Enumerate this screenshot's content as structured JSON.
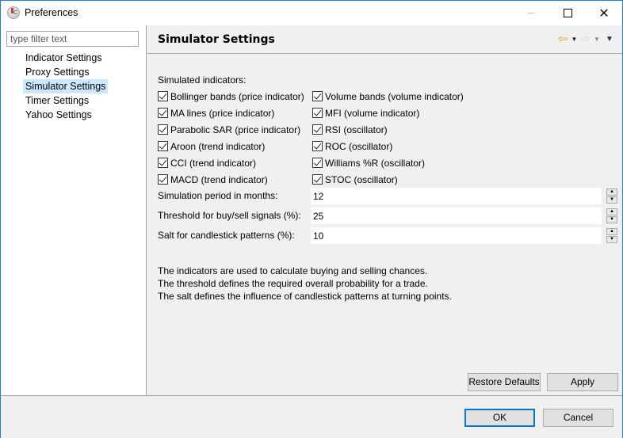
{
  "window": {
    "title": "Preferences",
    "icon": "java-app-icon",
    "controls": {
      "minimize": "minimize-icon",
      "maximize": "maximize-icon",
      "close": "close-icon"
    }
  },
  "sidebar": {
    "filter_placeholder": "type filter text",
    "filter_value": "",
    "items": [
      {
        "label": "Indicator Settings",
        "selected": false
      },
      {
        "label": "Proxy Settings",
        "selected": false
      },
      {
        "label": "Simulator Settings",
        "selected": true
      },
      {
        "label": "Timer Settings",
        "selected": false
      },
      {
        "label": "Yahoo Settings",
        "selected": false
      }
    ]
  },
  "page": {
    "title": "Simulator Settings",
    "nav": {
      "back_icon": "⇦",
      "back_dropdown_icon": "▼",
      "forward_icon": "⇨",
      "forward_dropdown_icon": "▼",
      "menu_icon": "▼"
    },
    "section_label": "Simulated indicators:",
    "checkboxes": [
      {
        "label": "Bollinger bands (price indicator)",
        "checked": true
      },
      {
        "label": "Volume bands (volume indicator)",
        "checked": true
      },
      {
        "label": "MA lines (price indicator)",
        "checked": true
      },
      {
        "label": "MFI (volume indicator)",
        "checked": true
      },
      {
        "label": "Parabolic SAR (price indicator)",
        "checked": true
      },
      {
        "label": "RSI (oscillator)",
        "checked": true
      },
      {
        "label": "Aroon (trend indicator)",
        "checked": true
      },
      {
        "label": "ROC (oscillator)",
        "checked": true
      },
      {
        "label": "CCI (trend indicator)",
        "checked": true
      },
      {
        "label": "Williams %R (oscillator)",
        "checked": true
      },
      {
        "label": "MACD (trend indicator)",
        "checked": true
      },
      {
        "label": "STOC (oscillator)",
        "checked": true
      }
    ],
    "fields": [
      {
        "label": "Simulation period in months:",
        "value": "12"
      },
      {
        "label": "Threshold for buy/sell signals (%):",
        "value": "25"
      },
      {
        "label": "Salt for candlestick patterns (%):",
        "value": "10"
      }
    ],
    "spinner_up": "▲",
    "spinner_down": "▼",
    "help_lines": [
      "The indicators are used to calculate buying and selling chances.",
      "The threshold defines the required overall probability for a trade.",
      "The salt defines the influence of candlestick patterns at turning points."
    ],
    "restore_defaults_label": "Restore Defaults",
    "apply_label": "Apply"
  },
  "footer": {
    "ok_label": "OK",
    "cancel_label": "Cancel"
  },
  "colors": {
    "selection": "#cce8ff",
    "window_border": "#1a7fd5",
    "default_button_border": "#0078d7",
    "back_arrow": "#e8b830"
  }
}
